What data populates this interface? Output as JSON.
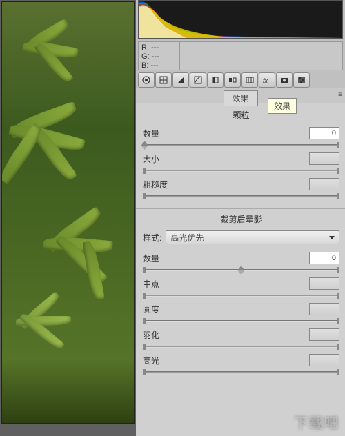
{
  "rgb": {
    "r_label": "R:",
    "g_label": "G:",
    "b_label": "B:",
    "r_val": "---",
    "g_val": "---",
    "b_val": "---"
  },
  "toolbar": {
    "icons": [
      "color-wheel",
      "grid",
      "exposure-triangle",
      "tone-curve",
      "detail",
      "split-tone",
      "lens",
      "fx",
      "camera",
      "presets"
    ]
  },
  "tabs": {
    "active": "效果",
    "tooltip": "效果"
  },
  "sections": {
    "grain": {
      "title": "颗粒",
      "amount_label": "数量",
      "amount_value": "0",
      "size_label": "大小",
      "size_value": "",
      "roughness_label": "粗糙度",
      "roughness_value": ""
    },
    "vignette": {
      "title": "裁剪后晕影",
      "style_label": "样式:",
      "style_value": "高光优先",
      "amount_label": "数量",
      "amount_value": "0",
      "midpoint_label": "中点",
      "midpoint_value": "",
      "roundness_label": "圆度",
      "roundness_value": "",
      "feather_label": "羽化",
      "feather_value": "",
      "highlight_label": "高光",
      "highlight_value": ""
    }
  },
  "watermark": "下载吧"
}
